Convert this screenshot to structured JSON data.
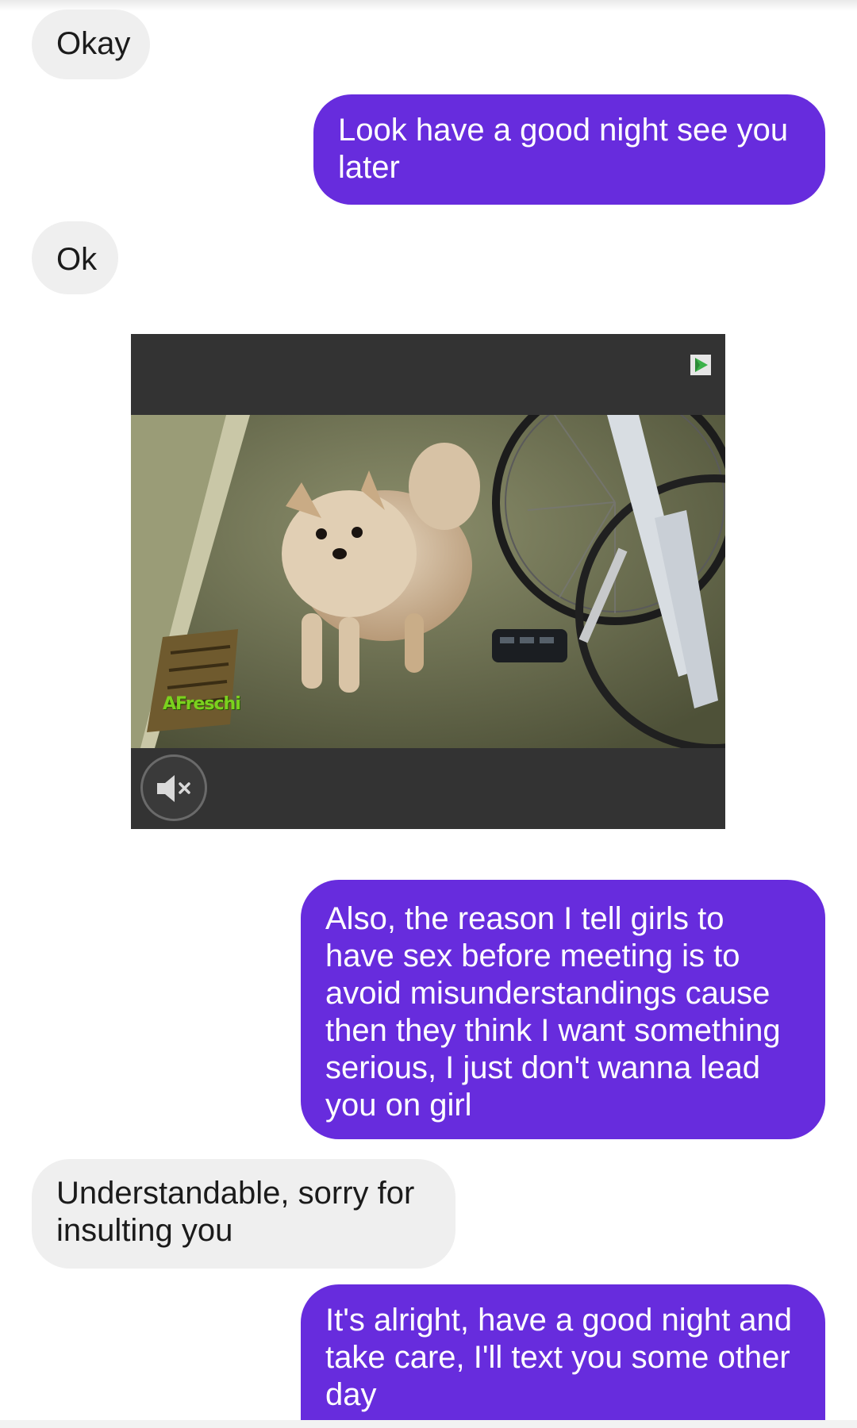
{
  "messages": [
    {
      "id": "m-okay",
      "direction": "incoming",
      "text": "Okay"
    },
    {
      "id": "m-look",
      "direction": "outgoing",
      "text": "Look have a good night see you later"
    },
    {
      "id": "m-ok",
      "direction": "incoming",
      "text": "Ok"
    },
    {
      "id": "m-also",
      "direction": "outgoing",
      "text": "Also, the reason I tell girls to have sex before meeting is to avoid misunderstandings cause then they think I want something serious, I just don't wanna lead you on girl"
    },
    {
      "id": "m-understand",
      "direction": "incoming",
      "text": "Understandable, sorry for insulting you"
    },
    {
      "id": "m-alright",
      "direction": "outgoing",
      "text": "It's alright, have a good night and take care, I'll text you some other day"
    }
  ],
  "ad": {
    "logo_text": "AFreschi",
    "badge_icon": "play-ad-icon",
    "mute_icon": "speaker-muted-icon"
  },
  "colors": {
    "outgoing_bubble": "#672cdd",
    "incoming_bubble": "#efefef",
    "ad_background": "#333333"
  }
}
